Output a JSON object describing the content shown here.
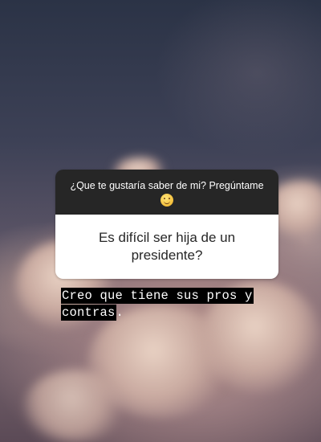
{
  "story": {
    "question_prompt": "¿Que te gustaría saber de mi? Pregúntame",
    "prompt_emoji": "hugging-face-emoji",
    "question_text": "Es difícil ser hija de un presidente?",
    "answer_line1": "Creo que tiene sus pros y",
    "answer_line2": "contras",
    "answer_trailing": "."
  },
  "colors": {
    "header_bg": "#262626",
    "body_bg": "#ffffff",
    "caption_highlight": "#000000"
  }
}
